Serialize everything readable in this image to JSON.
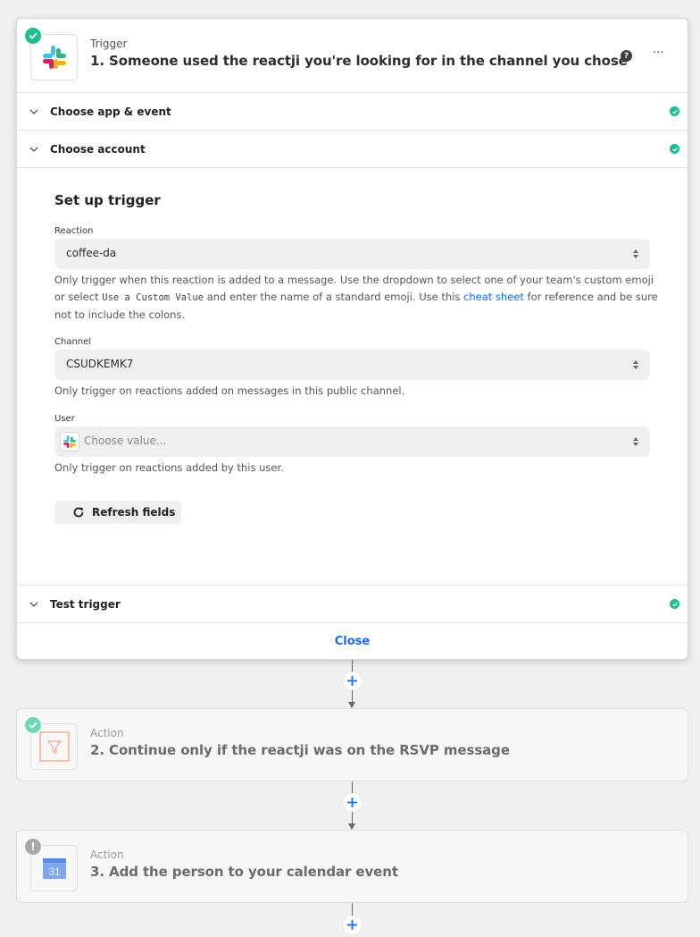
{
  "trigger": {
    "kind": "Trigger",
    "title": "1. Someone used the reactji you're looking for in the channel you chose",
    "status": "complete",
    "app_icon": "slack-icon",
    "help_icon": "help-icon",
    "more_label": "···",
    "sections": [
      {
        "label": "Choose app & event",
        "status": "complete"
      },
      {
        "label": "Choose account",
        "status": "complete"
      }
    ],
    "setup": {
      "title": "Set up trigger",
      "fields": [
        {
          "label": "Reaction",
          "value": "coffee-da",
          "help_prefix": "Only trigger when this reaction is added to a message. Use the dropdown to select one of your team's custom emoji or select ",
          "help_code": "Use a Custom Value",
          "help_middle": " and enter the name of a standard emoji. Use this ",
          "help_link": "cheat sheet",
          "help_suffix": " for reference and be sure not to include the colons."
        },
        {
          "label": "Channel",
          "value": "CSUDKEMK7",
          "help": "Only trigger on reactions added on messages in this public channel."
        },
        {
          "label": "User",
          "placeholder": "Choose value...",
          "help": "Only trigger on reactions added by this user."
        }
      ],
      "refresh_label": "Refresh fields"
    },
    "test_section": {
      "label": "Test trigger",
      "status": "complete"
    },
    "close_label": "Close"
  },
  "actions": [
    {
      "kind": "Action",
      "title": "2. Continue only if the reactji was on the RSVP message",
      "status": "complete",
      "app_icon": "filter-icon"
    },
    {
      "kind": "Action",
      "title": "3. Add the person to your calendar event",
      "status": "warning",
      "status_glyph": "!",
      "app_icon": "google-calendar-icon",
      "calendar_day": "31"
    }
  ],
  "colors": {
    "accent": "#136bf5",
    "success": "#1fbd92",
    "filter": "#ff4a00"
  }
}
